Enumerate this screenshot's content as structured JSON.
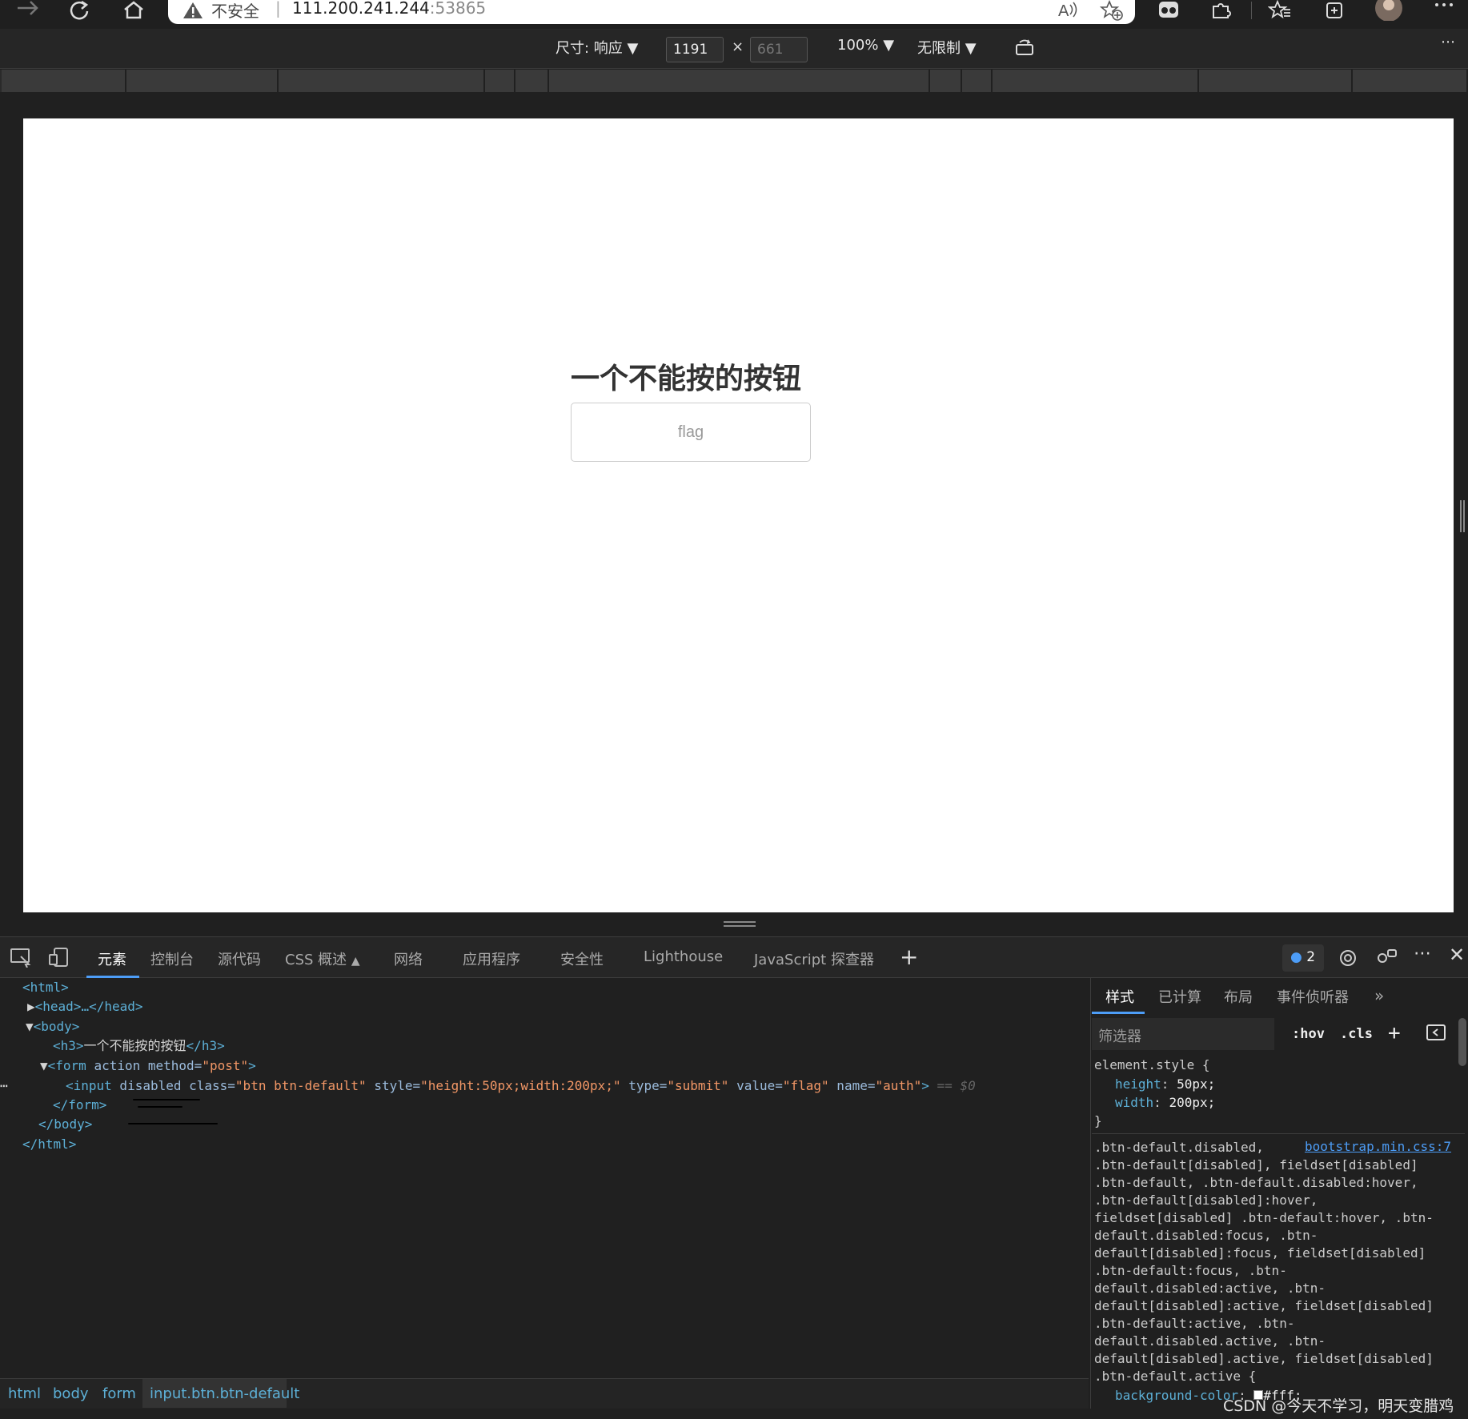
{
  "browser": {
    "security_label": "不安全",
    "url_host": "111.200.241.244",
    "url_port": ":53865"
  },
  "device_toolbar": {
    "size_label": "尺寸: 响应",
    "width": "1191",
    "height": "661",
    "zoom": "100%",
    "throttle": "无限制"
  },
  "page": {
    "heading": "一个不能按的按钮",
    "button_value": "flag"
  },
  "devtools": {
    "tabs": [
      "元素",
      "控制台",
      "源代码",
      "CSS 概述",
      "网络",
      "应用程序",
      "安全性",
      "Lighthouse",
      "JavaScript 探查器"
    ],
    "issues_count": "2",
    "dom": {
      "html_open": "<html>",
      "head": "<head>…</head>",
      "body_open": "<body>",
      "h3_open": "<h3>",
      "h3_text": "一个不能按的按钮",
      "h3_close": "</h3>",
      "form_tag": "<form",
      "form_attrs": " action method=",
      "form_method": "\"post\"",
      "form_end": ">",
      "input_tag": "<input",
      "input_attr_disabled": " disabled class=",
      "input_class": "\"btn btn-default\"",
      "input_attr_style": " style=",
      "input_style": "\"height:50px;width:200px;\"",
      "input_attr_type": " type=",
      "input_type": "\"submit\"",
      "input_attr_value": " value=",
      "input_value": "\"flag\"",
      "input_attr_name": " name=",
      "input_name": "\"auth\"",
      "input_end": ">",
      "selected_marker": "== $0",
      "form_close": "</form>",
      "body_close": "</body>",
      "html_close": "</html>"
    },
    "breadcrumb": [
      "html",
      "body",
      "form",
      "input.btn.btn-default"
    ],
    "styles": {
      "tabs": [
        "样式",
        "已计算",
        "布局",
        "事件侦听器"
      ],
      "filter_placeholder": "筛选器",
      "hov": ":hov",
      "cls": ".cls",
      "element_style_open": "element.style {",
      "prop_height": "height",
      "val_height": "50px;",
      "prop_width": "width",
      "val_width": "200px;",
      "element_style_close": "}",
      "source_link": "bootstrap.min.css:7",
      "selector_lines": [
        ".btn-default.disabled,",
        ".btn-default[disabled], fieldset[disabled]",
        ".btn-default, .btn-default.disabled:hover,",
        ".btn-default[disabled]:hover,",
        "fieldset[disabled] .btn-default:hover, .btn-",
        "default.disabled:focus, .btn-",
        "default[disabled]:focus, fieldset[disabled]",
        ".btn-default:focus, .btn-",
        "default.disabled:active, .btn-",
        "default[disabled]:active, fieldset[disabled]",
        ".btn-default:active, .btn-",
        "default.disabled.active, .btn-",
        "default[disabled].active, fieldset[disabled]",
        ".btn-default.active {"
      ],
      "prop_bg": "background-color",
      "val_bg": "#fff;"
    },
    "watermark": "CSDN @今天不学习，明天变腊鸡"
  }
}
